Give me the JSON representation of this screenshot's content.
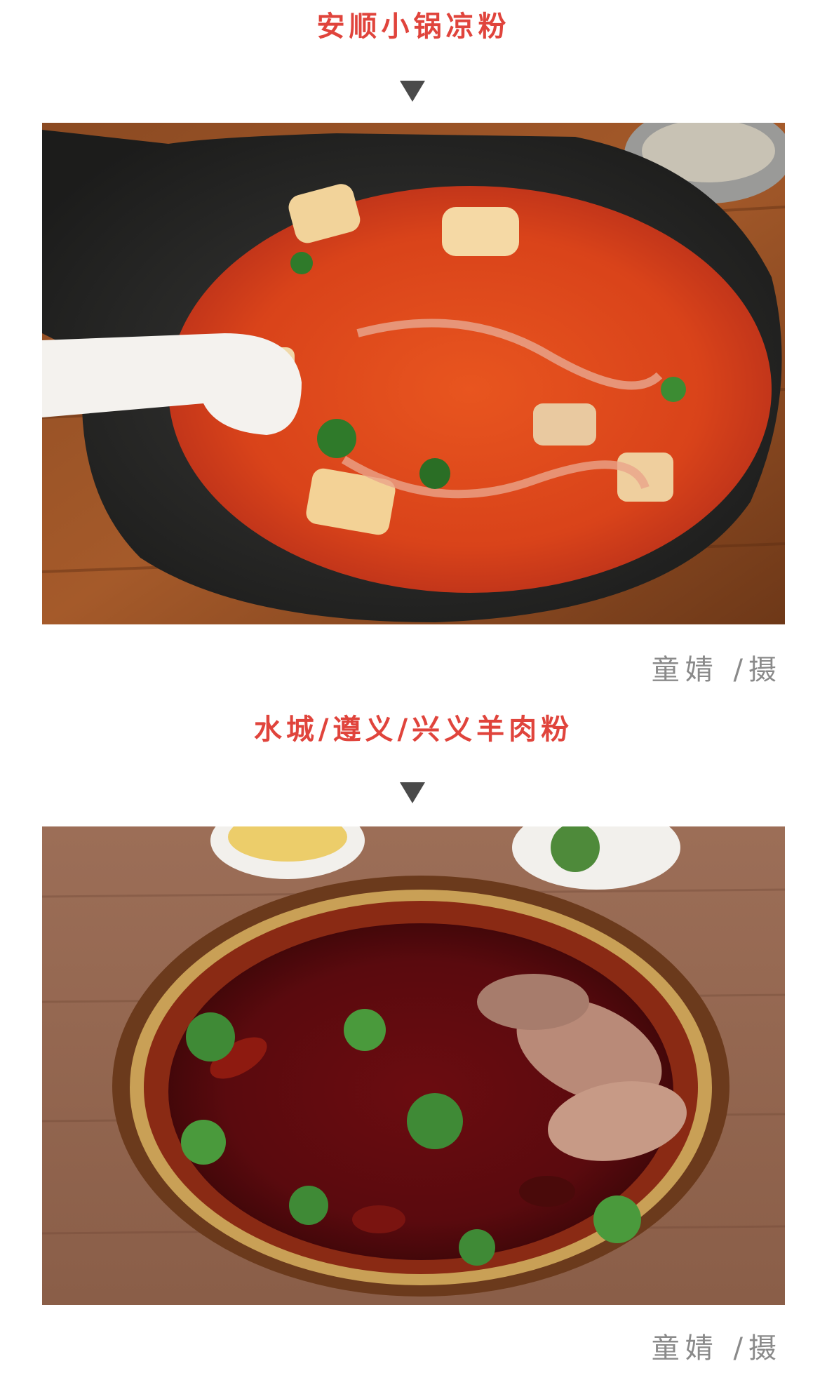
{
  "sections": [
    {
      "title": "安顺小锅凉粉",
      "photo_description": "",
      "credit": "童婧 /摄"
    },
    {
      "title": "水城/遵义/兴义羊肉粉",
      "photo_description": "",
      "credit": "童婧 /摄"
    }
  ],
  "icons": {
    "arrow": "down-triangle-icon"
  },
  "colors": {
    "title": "#e0443c",
    "credit": "#8a8a8a",
    "arrow": "#4a4a4a"
  }
}
